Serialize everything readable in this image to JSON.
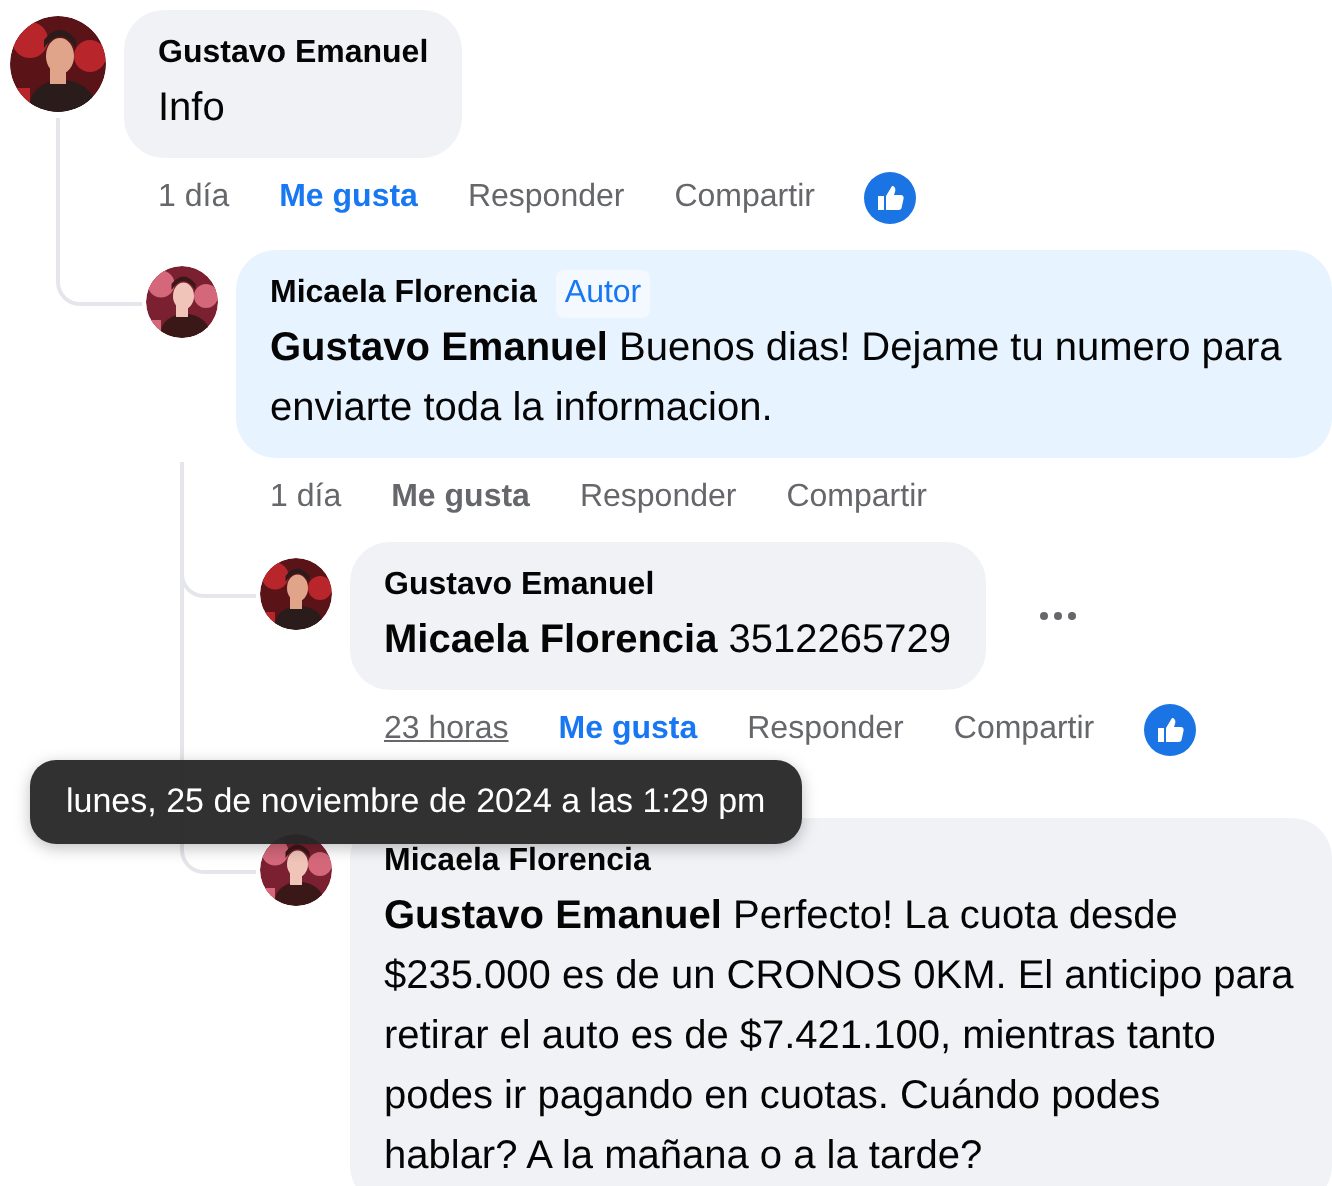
{
  "comments": [
    {
      "author": "Gustavo Emanuel",
      "text": "Info",
      "color": "#f0f2f5",
      "time": "1 día",
      "time_hovered": false,
      "like_label": "Me gusta",
      "liked": true,
      "reply_label": "Responder",
      "share_label": "Compartir",
      "has_reaction": true,
      "has_more_menu": false,
      "children": [
        {
          "author": "Micaela Florencia",
          "badge": "Autor",
          "text": "**Gustavo Emanuel** Buenos dias! Dejame tu numero para enviarte toda la informacion.",
          "color": "#e7f3ff",
          "time": "1 día",
          "time_hovered": false,
          "like_label": "Me gusta",
          "liked": false,
          "reply_label": "Responder",
          "share_label": "Compartir",
          "has_reaction": false,
          "has_more_menu": false,
          "children": [
            {
              "author": "Gustavo Emanuel",
              "text": "**Micaela Florencia** 3512265729",
              "color": "#f0f2f5",
              "time": "23 horas",
              "time_hovered": true,
              "like_label": "Me gusta",
              "liked": true,
              "reply_label": "Responder",
              "share_label": "Compartir",
              "has_reaction": true,
              "has_more_menu": true
            },
            {
              "author": "Micaela Florencia",
              "text": "**Gustavo Emanuel** Perfecto! La cuota desde $235.000 es de un CRONOS 0KM. El anticipo para retirar el auto es de $7.421.100, mientras tanto podes ir pagando en cuotas. Cuándo podes hablar? A la mañana o a la tarde?",
              "color": "#f0f2f5",
              "has_more_menu": false
            }
          ]
        }
      ]
    }
  ],
  "tooltip": {
    "text": "lunes, 25 de noviembre de 2024 a las 1:29 pm"
  }
}
